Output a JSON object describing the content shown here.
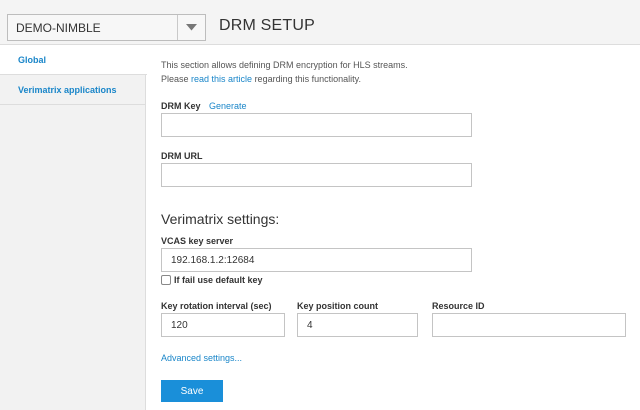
{
  "header": {
    "server_name": "DEMO-NIMBLE",
    "title": "DRM SETUP"
  },
  "sidebar": {
    "items": [
      {
        "label": "Global",
        "active": true
      },
      {
        "label": "Verimatrix applications",
        "active": false
      }
    ]
  },
  "intro": {
    "line1": "This section allows defining DRM encryption for HLS streams.",
    "line2_before": "Please ",
    "line2_link": "read this article",
    "line2_after": " regarding this functionality."
  },
  "drm": {
    "key_label": "DRM Key",
    "generate_label": "Generate",
    "key_value": "",
    "url_label": "DRM URL",
    "url_value": ""
  },
  "verimatrix": {
    "section_title": "Verimatrix settings:",
    "vcas_label": "VCAS key server",
    "vcas_value": "192.168.1.2:12684",
    "fallback_label": "If fail use default key",
    "fallback_checked": false,
    "rotation_label": "Key rotation interval (sec)",
    "rotation_value": "120",
    "position_label": "Key position count",
    "position_value": "4",
    "resource_label": "Resource ID",
    "resource_value": "",
    "advanced_label": "Advanced settings..."
  },
  "actions": {
    "save_label": "Save"
  },
  "colors": {
    "accent": "#1a8fd9",
    "link": "#1a86c9",
    "sidebar_bg": "#f2f2f2"
  }
}
